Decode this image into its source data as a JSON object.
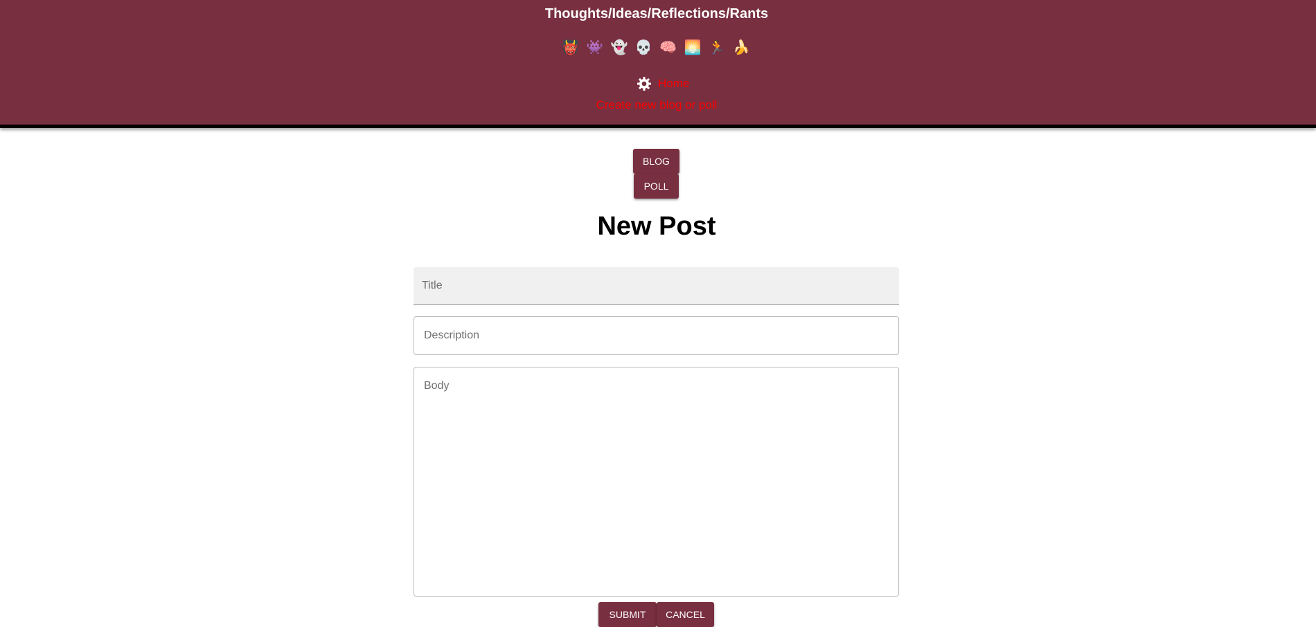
{
  "header": {
    "title": "Thoughts/Ideas/Reflections/Rants",
    "emojis": [
      "👹",
      "👾",
      "👻",
      "💀",
      "🧠",
      "🌅",
      "🏃",
      "🍌"
    ],
    "icon": "gear-icon",
    "home_label": "Home",
    "create_label": "Create new blog or poll"
  },
  "post_type": {
    "blog_label": "BLOG",
    "poll_label": "POLL"
  },
  "form": {
    "heading": "New Post",
    "title_placeholder": "Title",
    "description_placeholder": "Description",
    "body_placeholder": "Body",
    "submit_label": "SUBMIT",
    "cancel_label": "CANCEL"
  },
  "colors": {
    "brand": "#782f40",
    "link": "#ff0000",
    "header_border": "#000000"
  }
}
